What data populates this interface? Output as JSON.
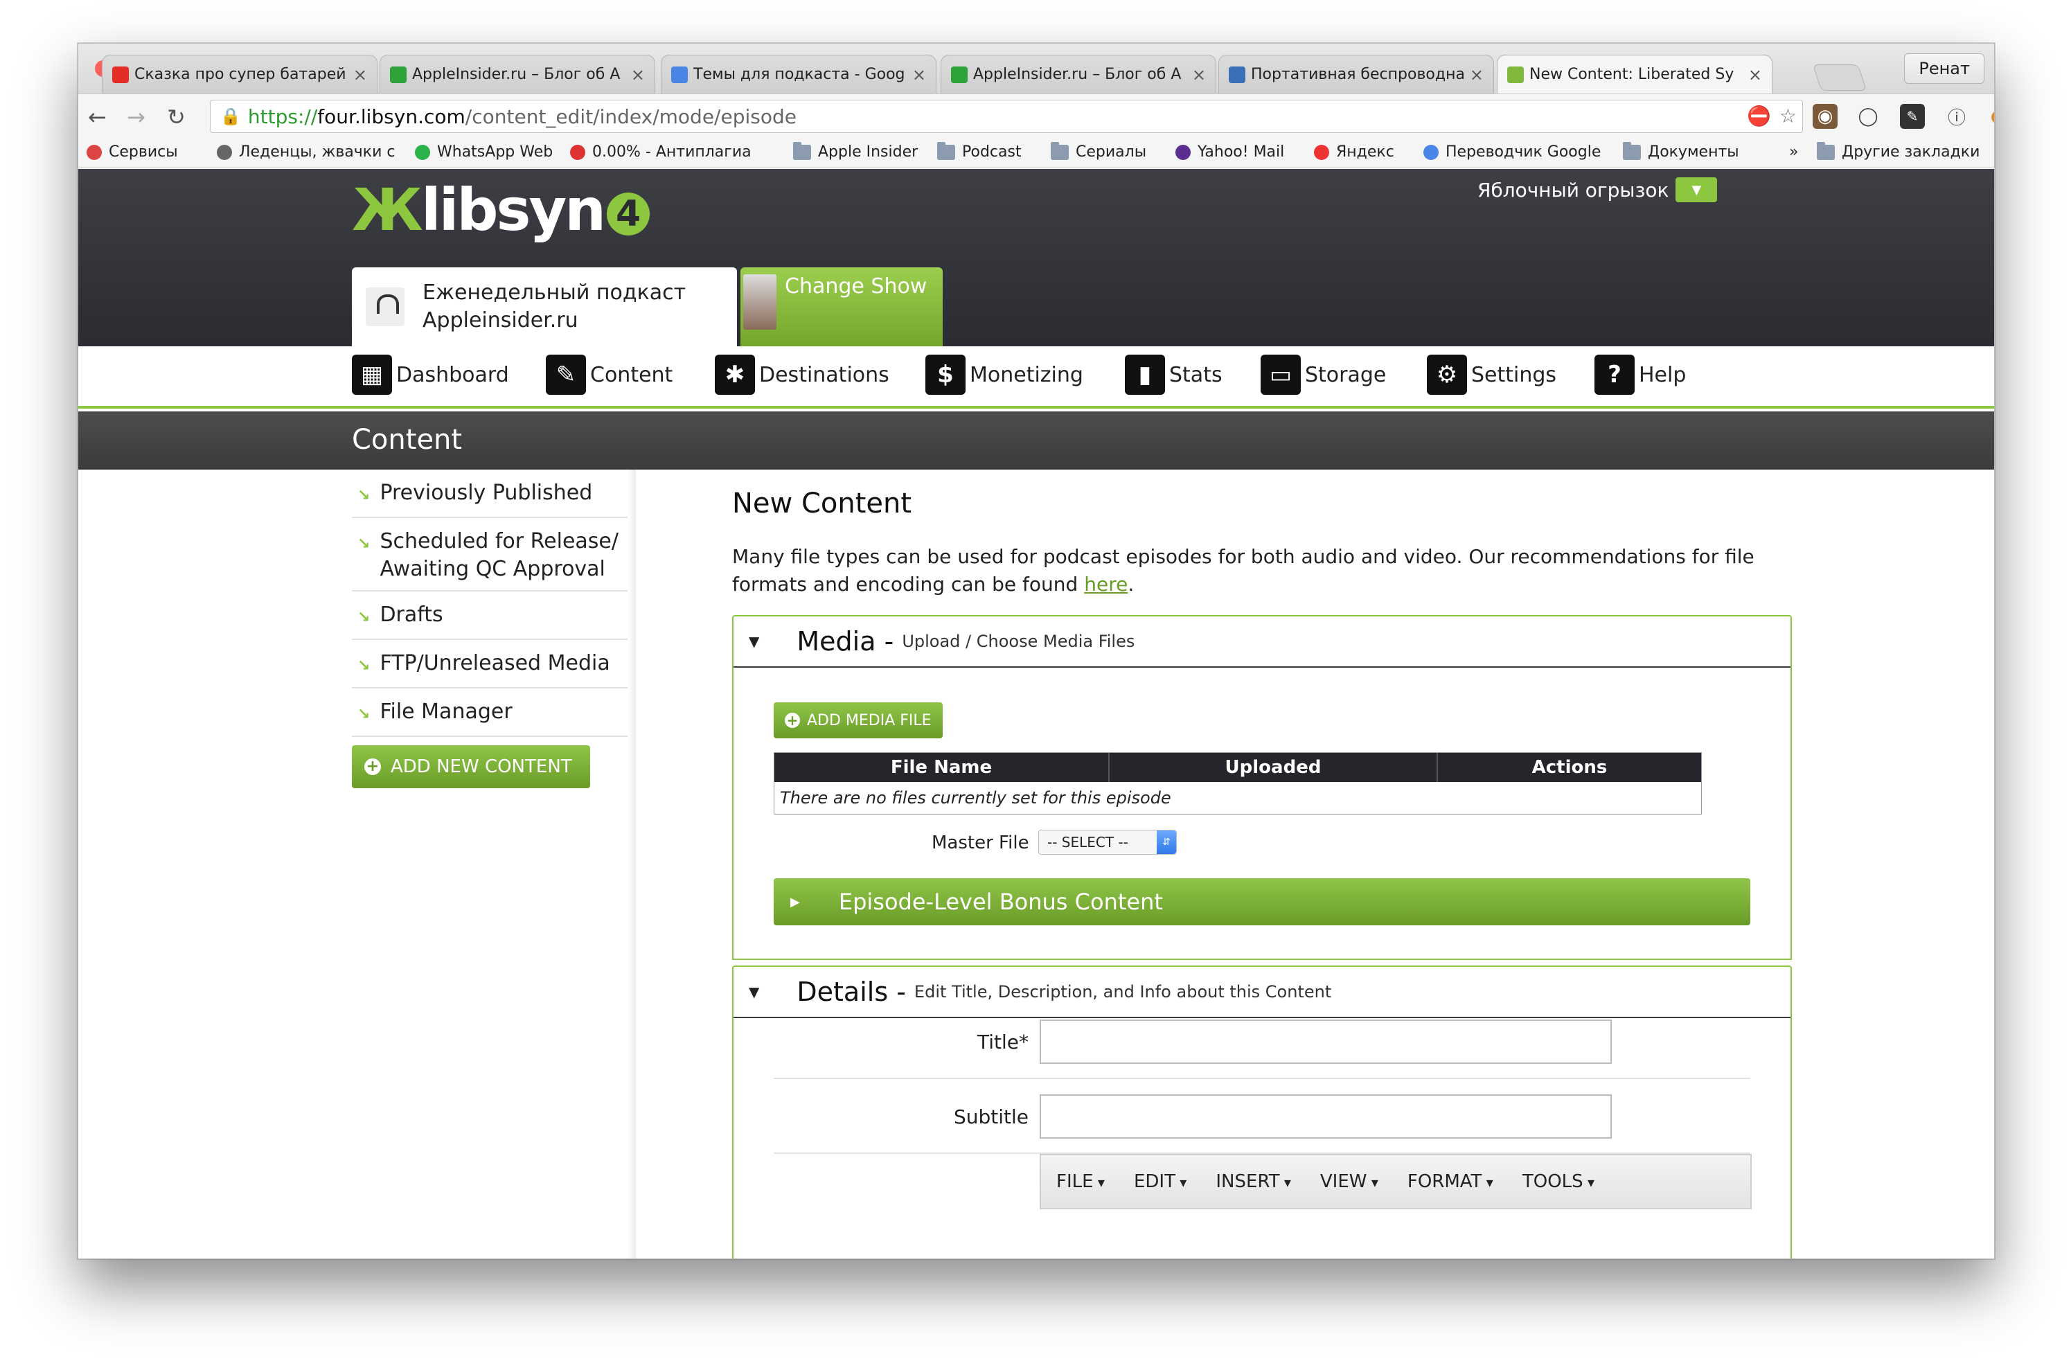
{
  "browser": {
    "tabs": [
      {
        "title": "Сказка про супер батарей",
        "icon": "youtube-icon",
        "color": "#e52d27"
      },
      {
        "title": "AppleInsider.ru – Блог об А",
        "icon": "green-circle-icon",
        "color": "#2ea33a"
      },
      {
        "title": "Темы для подкаста - Goog",
        "icon": "google-docs-icon",
        "color": "#4a86e8"
      },
      {
        "title": "AppleInsider.ru – Блог об А",
        "icon": "green-circle-icon",
        "color": "#2ea33a"
      },
      {
        "title": "Портативная беспроводна",
        "icon": "shield-icon",
        "color": "#3b6fb6"
      },
      {
        "title": "New Content: Liberated Sy",
        "icon": "libsyn-icon",
        "color": "#7fb83a"
      }
    ],
    "close_glyph": "×",
    "profile": "Ренат",
    "url": {
      "scheme": "https://",
      "host": "four.libsyn.com",
      "path": "/content_edit/index/mode/episode"
    },
    "bookmarks": [
      {
        "label": "Сервисы",
        "icon": "apps-grid-icon"
      },
      {
        "label": "Леденцы, жвачки с",
        "icon": "site-icon"
      },
      {
        "label": "WhatsApp Web",
        "icon": "whatsapp-icon"
      },
      {
        "label": "0.00% - Антиплагиа",
        "icon": "copyright-icon"
      },
      {
        "label": "Apple Insider",
        "icon": "folder-icon"
      },
      {
        "label": "Podcast",
        "icon": "folder-icon"
      },
      {
        "label": "Сериалы",
        "icon": "folder-icon"
      },
      {
        "label": "Yahoo! Mail",
        "icon": "yahoo-icon"
      },
      {
        "label": "Яндекс",
        "icon": "yandex-icon"
      },
      {
        "label": "Переводчик Google",
        "icon": "google-translate-icon"
      },
      {
        "label": "Документы",
        "icon": "folder-icon"
      },
      {
        "label": "Другие закладки",
        "icon": "folder-icon"
      }
    ],
    "bookmarks_more": "»"
  },
  "site": {
    "logo": {
      "prefix": "libsyn",
      "suffix": "4"
    },
    "account": "Яблочный огрызок",
    "show": {
      "name_line1": "Еженедельный подкаст",
      "name_line2": "Appleinsider.ru"
    },
    "change_show": "Change Show",
    "nav": [
      {
        "label": "Dashboard",
        "icon": "dashboard-icon",
        "glyph": "▦"
      },
      {
        "label": "Content",
        "icon": "content-icon",
        "glyph": "✎"
      },
      {
        "label": "Destinations",
        "icon": "destinations-icon",
        "glyph": "✱"
      },
      {
        "label": "Monetizing",
        "icon": "dollar-icon",
        "glyph": "$"
      },
      {
        "label": "Stats",
        "icon": "stats-icon",
        "glyph": "▮"
      },
      {
        "label": "Storage",
        "icon": "storage-icon",
        "glyph": "▭"
      },
      {
        "label": "Settings",
        "icon": "gear-icon",
        "glyph": "⚙"
      },
      {
        "label": "Help",
        "icon": "help-icon",
        "glyph": "?"
      }
    ],
    "section_title": "Content",
    "sidebar": {
      "items": [
        {
          "label": "Previously Published"
        },
        {
          "label": "Scheduled for Release/",
          "label2": "Awaiting QC Approval"
        },
        {
          "label": "Drafts"
        },
        {
          "label": "FTP/Unreleased Media"
        },
        {
          "label": "File Manager"
        }
      ],
      "add_button": "ADD NEW CONTENT"
    },
    "main": {
      "title": "New Content",
      "intro": "Many file types can be used for podcast episodes for both audio and video. Our recommendations for file formats and encoding can be found ",
      "intro_link": "here",
      "intro_end": ".",
      "media": {
        "title": "Media -",
        "subtitle": "Upload / Choose Media Files",
        "add_button": "ADD MEDIA FILE",
        "columns": [
          "File Name",
          "Uploaded",
          "Actions"
        ],
        "empty": "There are no files currently set for this episode",
        "master_label": "Master File",
        "master_value": "-- SELECT --",
        "bonus": "Episode-Level Bonus Content"
      },
      "details": {
        "title": "Details -",
        "subtitle": "Edit Title, Description, and Info about this Content",
        "fields": [
          {
            "label": "Title*",
            "value": ""
          },
          {
            "label": "Subtitle",
            "value": ""
          }
        ],
        "editor_menu": [
          "FILE",
          "EDIT",
          "INSERT",
          "VIEW",
          "FORMAT",
          "TOOLS"
        ]
      }
    }
  },
  "colors": {
    "accent": "#8dc63f",
    "header": "#2d2f34"
  }
}
